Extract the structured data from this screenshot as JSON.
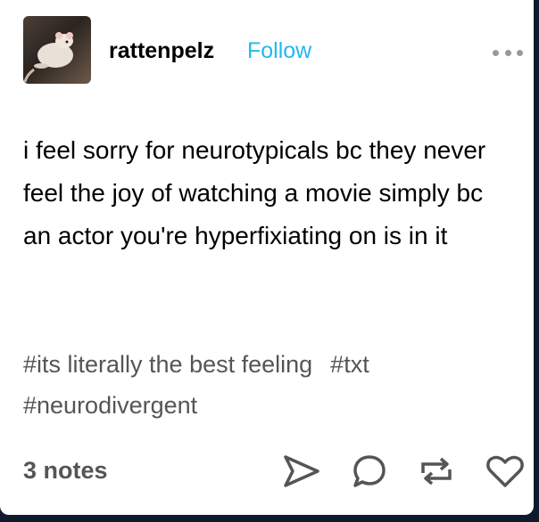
{
  "post": {
    "username": "rattenpelz",
    "follow_label": "Follow",
    "body": "i feel sorry for neurotypicals bc they never feel the joy of watching a movie simply bc an actor you're hyperfixiating on is in it",
    "tags": [
      "#its literally the best feeling",
      "#txt",
      "#neurodivergent"
    ],
    "notes": "3 notes"
  },
  "icons": {
    "more": "ellipsis-icon",
    "share": "send-icon",
    "reply": "comment-icon",
    "reblog": "reblog-icon",
    "like": "heart-icon"
  },
  "colors": {
    "follow": "#22b8f0",
    "icon": "#555555",
    "background": "#0f1b2d"
  }
}
